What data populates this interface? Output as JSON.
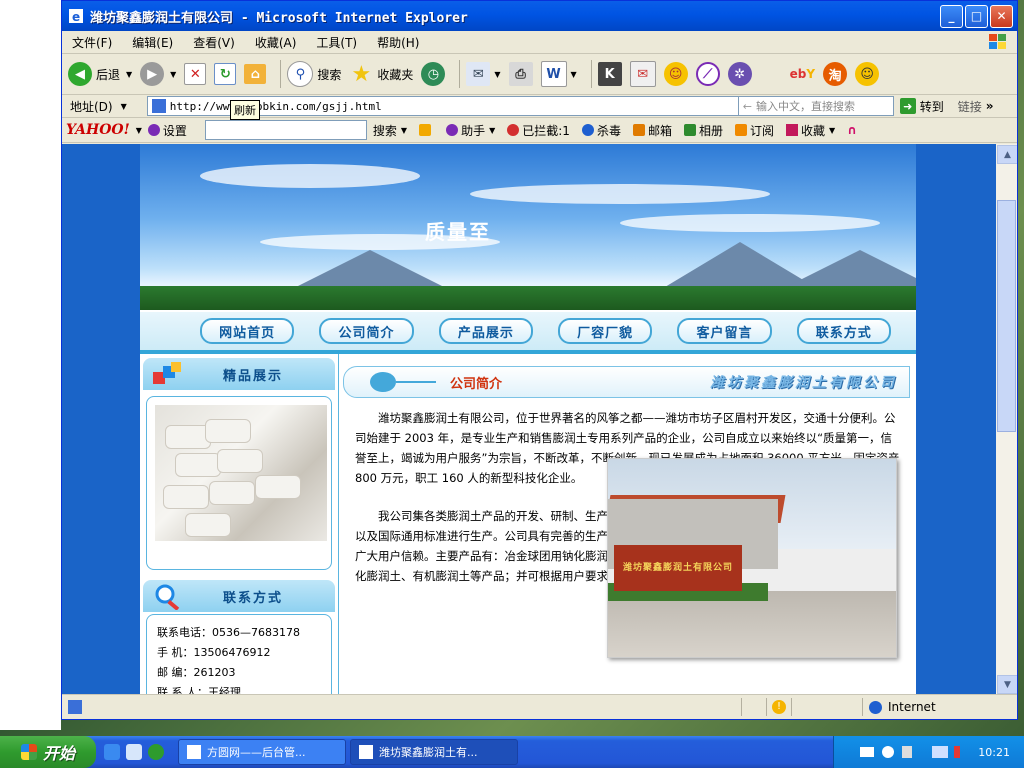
{
  "window": {
    "title": "潍坊聚鑫膨润土有限公司 - Microsoft Internet Explorer"
  },
  "menu": [
    "文件(F)",
    "编辑(E)",
    "查看(V)",
    "收藏(A)",
    "工具(T)",
    "帮助(H)"
  ],
  "toolbar": {
    "back": "后退",
    "search": "搜索",
    "favorites": "收藏夹"
  },
  "address": {
    "label": "地址(D)",
    "url": "http://www.jxpbkin.com/gsjj.html",
    "cn_placeholder": "输入中文，直接搜索",
    "go": "转到",
    "links": "链接"
  },
  "tooltip": "刷新",
  "yahoo_bar": {
    "logo": "YAHOO!",
    "settings": "设置",
    "search": "搜索",
    "helper": "助手",
    "blocked": "已拦截:1",
    "antivirus": "杀毒",
    "mail": "邮箱",
    "album": "相册",
    "subscribe": "订阅",
    "favorite": "收藏"
  },
  "banner": {
    "text": "质量至"
  },
  "nav": [
    "网站首页",
    "公司简介",
    "产品展示",
    "厂容厂貌",
    "客户留言",
    "联系方式"
  ],
  "sidebar": {
    "products_title": "精品展示",
    "contact_title": "联系方式",
    "contact": [
      "联系电话：0536—7683178",
      "手 机：13506476912",
      "邮 编：261203",
      "联 系 人：王经理"
    ]
  },
  "main": {
    "section_title": "公司简介",
    "company_logo": "潍坊聚鑫膨润土有限公司",
    "paragraph1": "潍坊聚鑫膨润土有限公司，位于世界著名的风筝之都——潍坊市坊子区眉村开发区，交通十分便利。公司始建于 2003 年，是专业生产和销售膨润土专用系列产品的企业，公司自成立以来始终以“质量第一，信誉至上，竭诚为用户服务”为宗旨，不断改革，不断创新，现已发展成为占地面积 36000 平方米，固定资产 800 万元，职工 160 人的新型科技化企业。",
    "paragraph2": "我公司集各类膨润土产品的开发、研制、生产、销售为一体，所生产的各类膨润土产品均按国标、部标以及国际通用标准进行生产。公司具有完善的生产设备和质量检测设备，严格执行各项指标性能要求，深为广大用户信赖。主要产品有：冶金球团用钠化膨润土、铸造、复合肥专用土、用钠化膨润土、钻井泥浆用钠化膨润土、有机膨润土等产品；并可根据用户要求生",
    "photo_sign": "潍坊聚鑫膨润土有限公司"
  },
  "statusbar": {
    "zone": "Internet"
  },
  "taskbar": {
    "start": "开始",
    "tasks": [
      "方圆网——后台管...",
      "潍坊聚鑫膨润土有..."
    ],
    "clock": "10:21"
  }
}
